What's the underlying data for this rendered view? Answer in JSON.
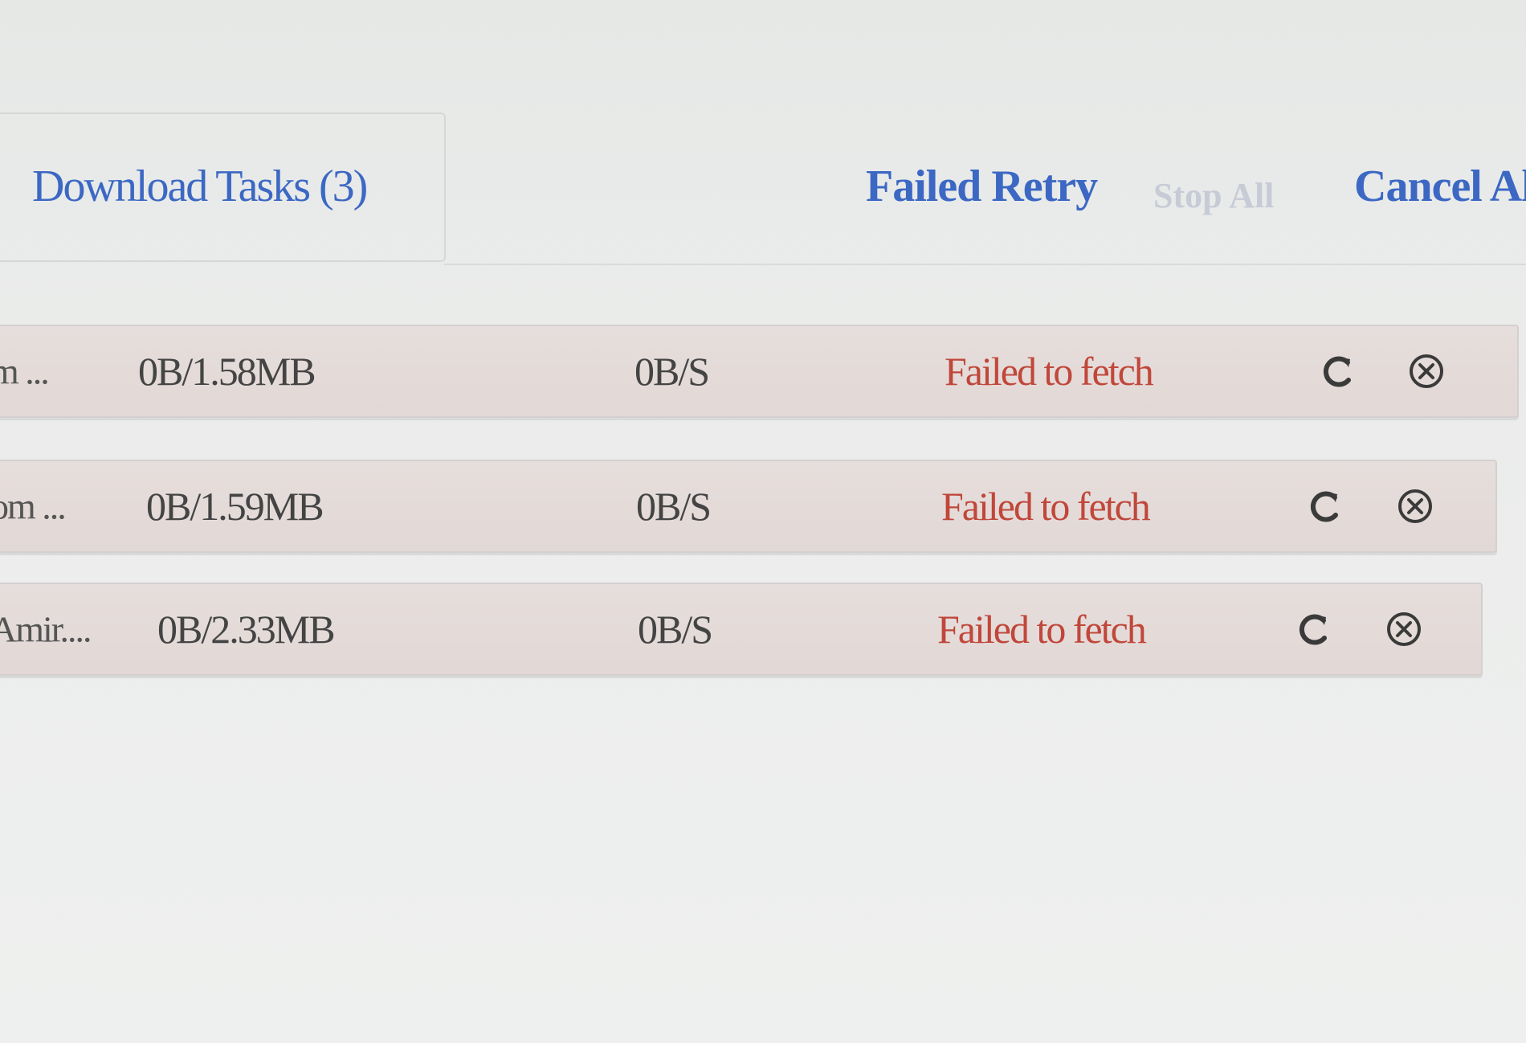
{
  "header": {
    "tab_title": "Download Tasks (3)",
    "actions": {
      "retry_label": "Failed Retry",
      "stop_label": "Stop All",
      "cancel_label": "Cancel Al"
    }
  },
  "tasks": [
    {
      "name": "m ...",
      "size": "0B/1.58MB",
      "speed": "0B/S",
      "status": "Failed to fetch",
      "retry_icon": "retry-icon",
      "cancel_icon": "cancel-circle-icon"
    },
    {
      "name": "om ...",
      "size": "0B/1.59MB",
      "speed": "0B/S",
      "status": "Failed to fetch",
      "retry_icon": "retry-icon",
      "cancel_icon": "cancel-circle-icon"
    },
    {
      "name": "Amir....",
      "size": "0B/2.33MB",
      "speed": "0B/S",
      "status": "Failed to fetch",
      "retry_icon": "retry-icon",
      "cancel_icon": "cancel-circle-icon"
    }
  ],
  "colors": {
    "link_blue": "#3c68c4",
    "disabled_link": "#c6cbd6",
    "error_red": "#c0473a",
    "row_background": "#e4dbd9",
    "page_background": "#eceeed"
  }
}
